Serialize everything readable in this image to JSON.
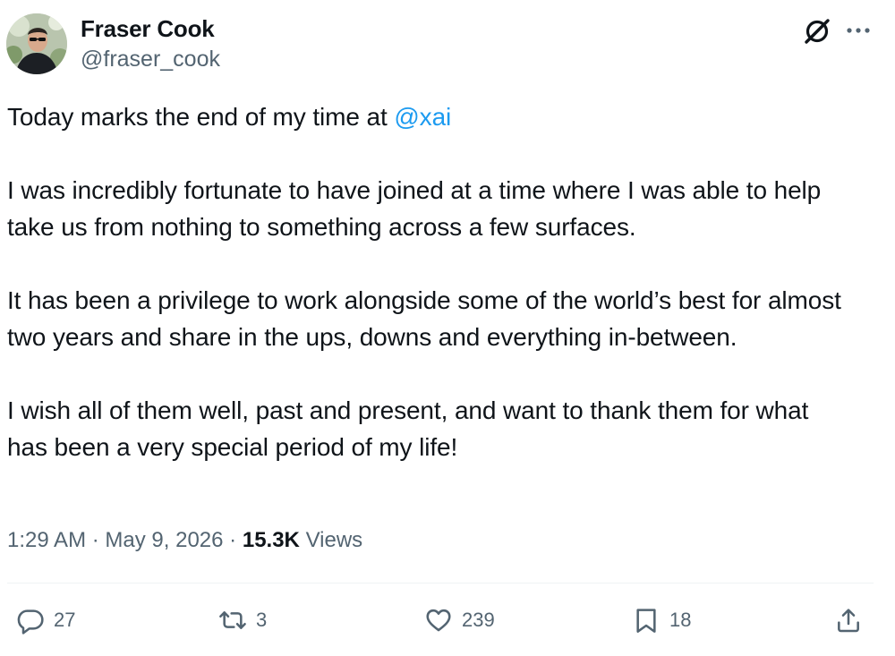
{
  "author": {
    "name": "Fraser Cook",
    "handle": "@fraser_cook"
  },
  "header_icons": [
    "grok-icon",
    "more-icon"
  ],
  "body": {
    "p1_text": "Today marks the end of my time at ",
    "p1_mention": "@xai",
    "p2": "I was incredibly fortunate to have joined at a time where I was able to help take us from nothing to something across a few surfaces.",
    "p3": "It has been a privilege to work alongside some of the world’s best for almost two years and share in the ups, downs and everything in-between.",
    "p4": "I wish all of them well, past and present, and want to thank them for what has been a very special period of my life!"
  },
  "meta": {
    "time": "1:29 AM",
    "separator": "·",
    "date": "May 9, 2026",
    "views_count": "15.3K",
    "views_label": "Views"
  },
  "actions": {
    "replies": "27",
    "reposts": "3",
    "likes": "239",
    "bookmarks": "18"
  },
  "colors": {
    "text": "#0f1419",
    "secondary": "#536471",
    "link": "#1d9bf0",
    "divider": "#eff3f4"
  }
}
